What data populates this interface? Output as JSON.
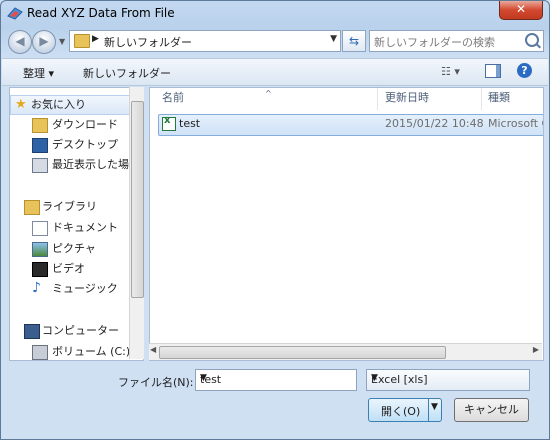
{
  "window": {
    "title": "Read XYZ Data From File",
    "close_label": "✕"
  },
  "address": {
    "path": "新しいフォルダー"
  },
  "search": {
    "placeholder": "新しいフォルダーの検索"
  },
  "toolbar": {
    "organize": "整理 ▾",
    "new_folder": "新しいフォルダー",
    "view": "☷ ▾",
    "help": "?"
  },
  "nav": {
    "favorites": "お気に入り",
    "downloads": "ダウンロード",
    "desktop": "デスクトップ",
    "recent": "最近表示した場所",
    "libraries": "ライブラリ",
    "documents": "ドキュメント",
    "pictures": "ピクチャ",
    "videos": "ビデオ",
    "music": "ミュージック",
    "computer": "コンピューター",
    "volume": "ボリューム (C:)"
  },
  "columns": {
    "name": "名前",
    "modified": "更新日時",
    "type": "種類"
  },
  "files": [
    {
      "name": "test",
      "modified": "2015/01/22 10:48",
      "type": "Microsoft O"
    }
  ],
  "filename": {
    "label": "ファイル名(N):",
    "value": "test"
  },
  "filetype": {
    "value": "Excel [xls]"
  },
  "buttons": {
    "open": "開く(O)",
    "cancel": "キャンセル"
  }
}
